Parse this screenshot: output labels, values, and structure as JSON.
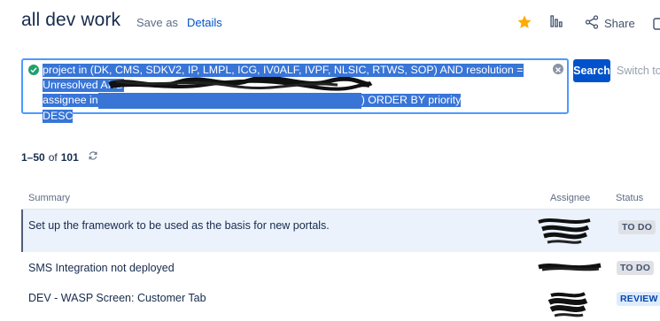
{
  "header": {
    "title": "all dev work",
    "save_as": "Save as",
    "details": "Details",
    "share": "Share"
  },
  "query": {
    "line1": "project in (DK, CMS, SDKV2, IP, LMPL, ICG, IV0ALF, IVPF, NLSIC, RTWS, SOP) AND resolution = Unresolved AND",
    "line2_start": "assignee in",
    "line2_end": ") ORDER BY priority",
    "line3": "DESC"
  },
  "search_button": "Search",
  "switch_to": "Switch to",
  "results": {
    "range": "1–50",
    "of": "of",
    "total": "101"
  },
  "table": {
    "columns": [
      "Summary",
      "Assignee",
      "Status"
    ],
    "rows": [
      {
        "summary": "Set up the framework to be used as the basis for new portals.",
        "status": "TO DO"
      },
      {
        "summary": "SMS Integration not deployed",
        "status": "TO DO"
      },
      {
        "summary": "DEV - WASP Screen: Customer Tab",
        "status": "REVIEW"
      }
    ]
  },
  "colors": {
    "accent": "#0052cc",
    "star": "#ffab00",
    "selection": "#3875d7",
    "row_highlight": "#ebf2fc"
  },
  "icons": [
    "star-icon",
    "chart-icon",
    "share-icon",
    "check-circle-icon",
    "clear-icon",
    "refresh-icon"
  ]
}
